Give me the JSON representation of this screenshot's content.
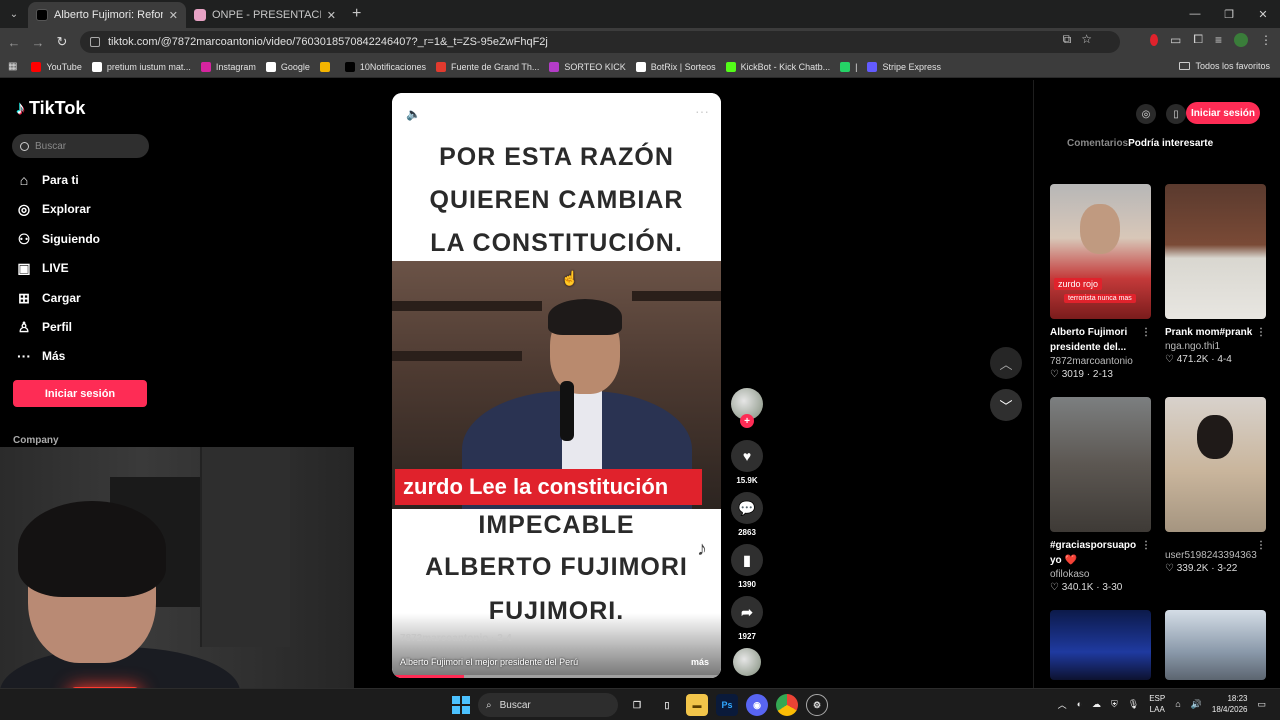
{
  "browser": {
    "tabs": [
      {
        "title": "Alberto Fujimori: Reformas y Et",
        "active": true,
        "color": "#ffffff"
      },
      {
        "title": "ONPE - PRESENTACIÓN DE RES",
        "active": false,
        "color": "#e7a2c4"
      }
    ],
    "url": "tiktok.com/@7872marcoantonio/video/7603018570842246407?_r=1&_t=ZS-95eZwFhqF2j",
    "bookmarks": [
      {
        "label": "YouTube",
        "color": "#ff0000"
      },
      {
        "label": "pretium iustum mat...",
        "color": "#ffffff"
      },
      {
        "label": "Instagram",
        "color": "#d6249f"
      },
      {
        "label": "Google",
        "color": "#ffffff"
      },
      {
        "label": "",
        "color": "#f4b400"
      },
      {
        "label": "10Notificaciones",
        "color": "#000000"
      },
      {
        "label": "Fuente de Grand Th...",
        "color": "#e23a2e"
      },
      {
        "label": "SORTEO KICK",
        "color": "#b43cc8"
      },
      {
        "label": "BotRix | Sorteos",
        "color": "#ffffff"
      },
      {
        "label": "KickBot - Kick Chatb...",
        "color": "#53fc18"
      },
      {
        "label": "|",
        "color": "#25d366"
      },
      {
        "label": "Stripe Express",
        "color": "#635bff"
      }
    ],
    "all_favorites": "Todos los favoritos"
  },
  "sidebar": {
    "brand": "TikTok",
    "search_placeholder": "Buscar",
    "items": [
      {
        "label": "Para ti",
        "icon": "home-icon"
      },
      {
        "label": "Explorar",
        "icon": "compass-icon"
      },
      {
        "label": "Siguiendo",
        "icon": "following-icon"
      },
      {
        "label": "LIVE",
        "icon": "live-icon"
      },
      {
        "label": "Cargar",
        "icon": "upload-icon"
      },
      {
        "label": "Perfil",
        "icon": "profile-icon"
      },
      {
        "label": "Más",
        "icon": "more-icon"
      }
    ],
    "login": "Iniciar sesión",
    "company": "Company"
  },
  "video": {
    "lines_top": [
      "POR ESTA RAZÓN",
      "QUIEREN CAMBIAR",
      "LA  CONSTITUCIÓN."
    ],
    "caption_red": "zurdo Lee la constitución",
    "lines_bottom": [
      "IMPECABLE",
      "ALBERTO FUJIMORI",
      "FUJIMORI."
    ],
    "username": "7872marcoantonio · 2-4",
    "description": "Alberto Fujimori el mejor presidente del Perú",
    "more": "más",
    "progress": 0.22
  },
  "actions": {
    "likes": "15.9K",
    "comments": "2863",
    "saves": "1390",
    "shares": "1927"
  },
  "right_panel": {
    "login": "Iniciar sesión",
    "tabs": [
      "Comentarios",
      "Podría interesarte"
    ],
    "cards": [
      {
        "title": "Alberto Fujimori presidente del...",
        "user": "7872marcoantonio",
        "likes": "3019",
        "date": "2-13",
        "tag1": "zurdo rojo",
        "tag2": "terrorista nunca mas"
      },
      {
        "title": "Prank mom#prank",
        "user": "nga.ngo.thi1",
        "likes": "471.2K",
        "date": "4-4"
      },
      {
        "title": "#graciasporsuapo yo ❤️",
        "user": "ofilokaso",
        "likes": "340.1K",
        "date": "3-30"
      },
      {
        "title": "",
        "user": "user5198243394363",
        "likes": "339.2K",
        "date": "3-22"
      }
    ]
  },
  "taskbar": {
    "search": "Buscar",
    "lang1": "ESP",
    "lang2": "LAA",
    "time": "18:23",
    "date": "18/4/2026"
  }
}
